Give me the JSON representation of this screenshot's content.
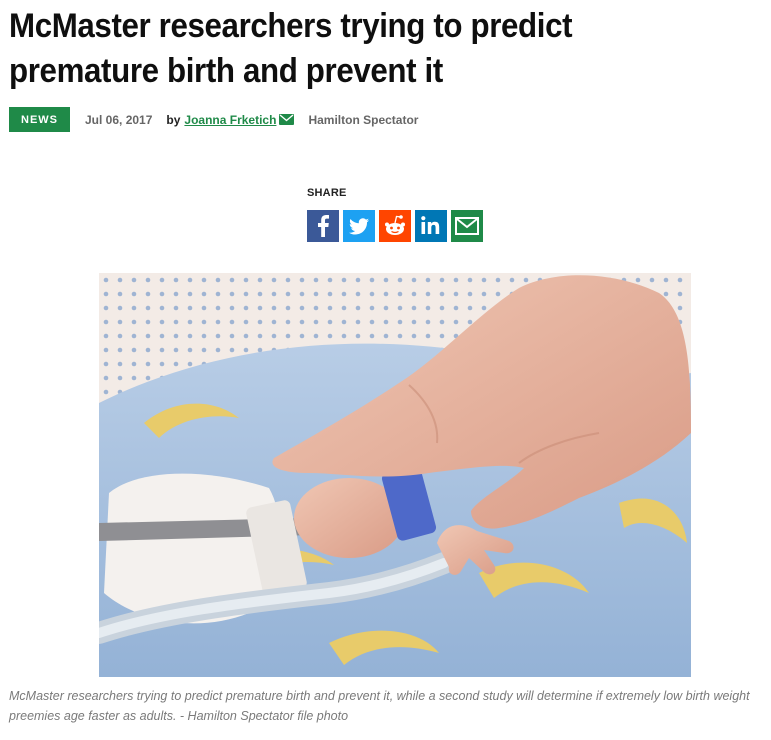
{
  "article": {
    "headline": "McMaster researchers trying to predict premature birth and prevent it",
    "category": "NEWS",
    "date": "Jul 06, 2017",
    "by_label": "by",
    "author": "Joanna Frketich",
    "source": "Hamilton Spectator"
  },
  "share": {
    "label": "SHARE",
    "buttons": [
      {
        "name": "facebook",
        "icon": "facebook-icon",
        "color": "#3b5998"
      },
      {
        "name": "twitter",
        "icon": "twitter-icon",
        "color": "#1da1f2"
      },
      {
        "name": "reddit",
        "icon": "reddit-icon",
        "color": "#ff4500"
      },
      {
        "name": "linkedin",
        "icon": "linkedin-icon",
        "color": "#0077b5"
      },
      {
        "name": "email",
        "icon": "email-icon",
        "color": "#1f8a48"
      }
    ]
  },
  "photo": {
    "caption": "McMaster researchers trying to predict premature birth and prevent it, while a second study will determine if extremely low birth weight preemies age faster as adults. - Hamilton Spectator file photo"
  },
  "colors": {
    "accent": "#1f8a48",
    "meta_gray": "#666666",
    "caption_gray": "#7a7a7a"
  }
}
